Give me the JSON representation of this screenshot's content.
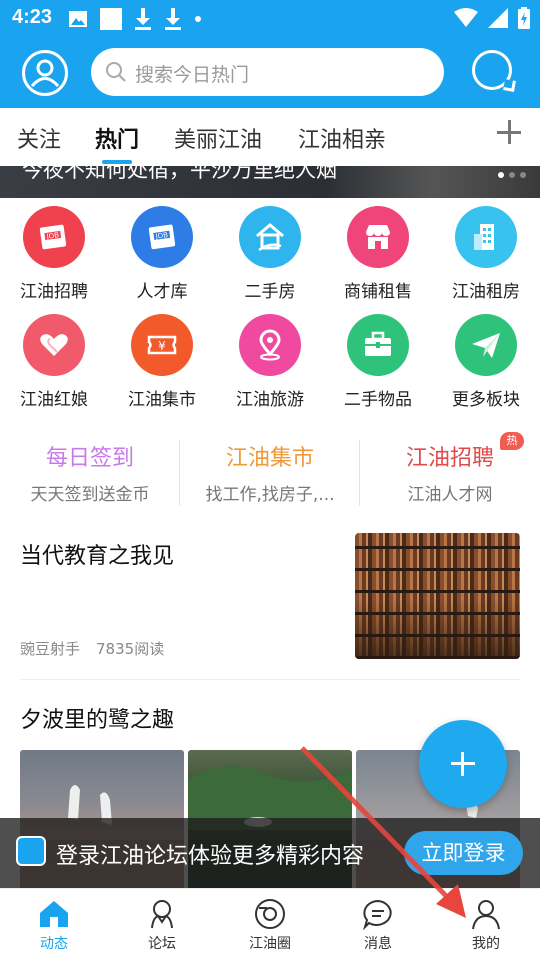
{
  "status_bar": {
    "time": "4:23"
  },
  "header": {
    "search_placeholder": "搜索今日热门"
  },
  "tabs": [
    {
      "label": "关注"
    },
    {
      "label": "热门"
    },
    {
      "label": "美丽江油"
    },
    {
      "label": "江油相亲"
    }
  ],
  "banner": {
    "caption": "今夜不知何处宿，平沙万里绝人烟"
  },
  "grid": [
    {
      "label": "江油招聘",
      "icon": "job-icon",
      "color": "#f0414e"
    },
    {
      "label": "人才库",
      "icon": "talent-icon",
      "color": "#2e7de6"
    },
    {
      "label": "二手房",
      "icon": "house-icon",
      "color": "#2fb5ee"
    },
    {
      "label": "商铺租售",
      "icon": "shop-icon",
      "color": "#f0457a"
    },
    {
      "label": "江油租房",
      "icon": "building-icon",
      "color": "#37c3ee"
    },
    {
      "label": "江油红娘",
      "icon": "heart-icon",
      "color": "#f05a6a"
    },
    {
      "label": "江油集市",
      "icon": "ticket-icon",
      "color": "#f25a2c"
    },
    {
      "label": "江油旅游",
      "icon": "location-pin-icon",
      "color": "#f04aa0"
    },
    {
      "label": "二手物品",
      "icon": "briefcase-icon",
      "color": "#2fc27a"
    },
    {
      "label": "更多板块",
      "icon": "paper-plane-icon",
      "color": "#2fc27a"
    }
  ],
  "quick_links": [
    {
      "title": "每日签到",
      "subtitle": "天天签到送金币",
      "color": "#c77ae8"
    },
    {
      "title": "江油集市",
      "subtitle": "找工作,找房子,...",
      "color": "#ee9a3a"
    },
    {
      "title": "江油招聘",
      "subtitle": "江油人才网",
      "color": "#e04b4b",
      "badge": "热"
    }
  ],
  "articles": [
    {
      "title": "当代教育之我见",
      "author": "豌豆射手",
      "reads": "7835阅读"
    },
    {
      "title": "夕波里的鹭之趣"
    }
  ],
  "login_prompt": {
    "text": "登录江油论坛体验更多精彩内容",
    "button": "立即登录"
  },
  "bottom_nav": [
    {
      "label": "动态",
      "icon": "home-icon",
      "active": true
    },
    {
      "label": "论坛",
      "icon": "forum-icon"
    },
    {
      "label": "江油圈",
      "icon": "camera-circle-icon"
    },
    {
      "label": "消息",
      "icon": "message-icon"
    },
    {
      "label": "我的",
      "icon": "person-icon"
    }
  ],
  "colors": {
    "brand": "#1aa3ee",
    "arrow": "#e8453c"
  }
}
